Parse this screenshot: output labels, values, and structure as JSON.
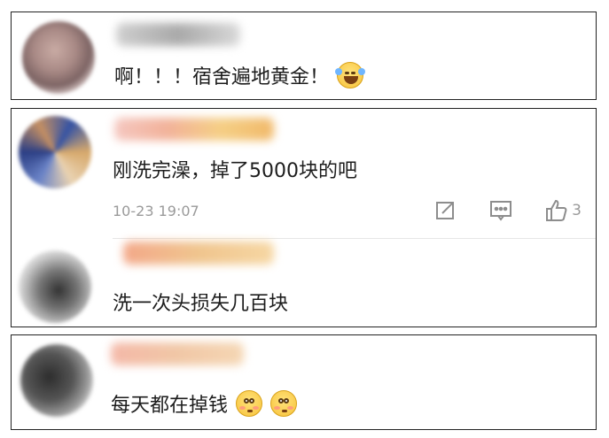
{
  "comments": [
    {
      "text": "啊！！！宿舍遍地黄金！",
      "emoji": "laughing-tears-emoji"
    },
    {
      "text": "刚洗完澡，掉了5000块的吧",
      "time": "10-23 19:07",
      "likes": "3",
      "reply": {
        "text": "洗一次头损失几百块"
      }
    },
    {
      "text": "每天都在掉钱",
      "emoji": "flushed-face-emoji"
    }
  ]
}
